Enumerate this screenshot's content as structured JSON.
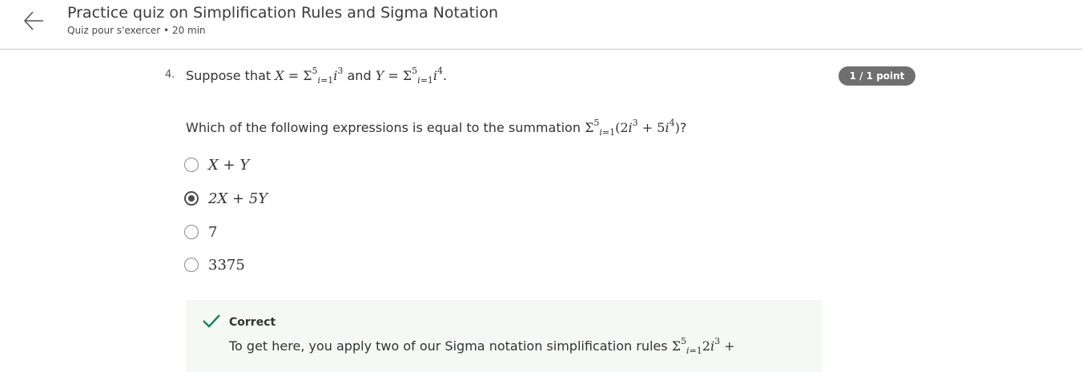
{
  "header": {
    "title": "Practice quiz on Simplification Rules and Sigma Notation",
    "subtitle": "Quiz pour s'exercer • 20 min"
  },
  "question": {
    "number": "4.",
    "stem_prefix": "Suppose that",
    "stem_and": "and",
    "prompt_text": "Which of the following expressions is equal to the summation",
    "points_badge": "1 / 1 point",
    "options": [
      {
        "label": "X + Y",
        "selected": false
      },
      {
        "label": "2X + 5Y",
        "selected": true
      },
      {
        "label": "7",
        "selected": false
      },
      {
        "label": "3375",
        "selected": false
      }
    ]
  },
  "feedback": {
    "status": "Correct",
    "text": "To get here, you apply two of our Sigma notation simplification rules"
  },
  "colors": {
    "badge_bg": "#6f6f6f",
    "correct_green": "#1f8354",
    "feedback_bg": "#f4f9f6"
  }
}
